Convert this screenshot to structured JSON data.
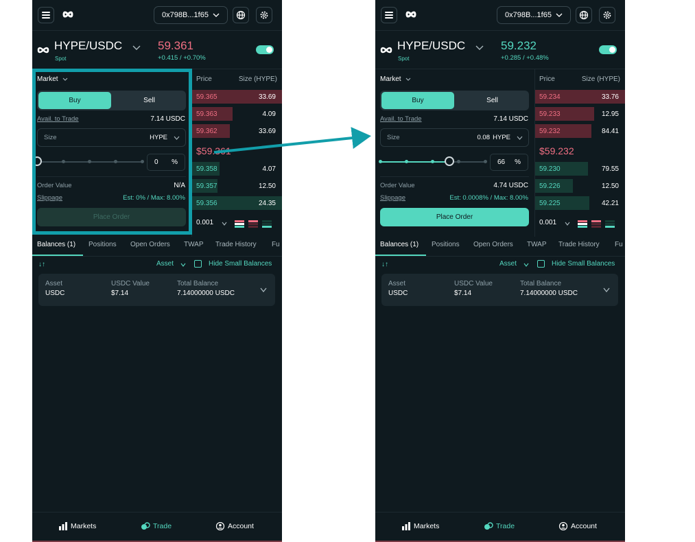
{
  "colors": {
    "bg": "#0f1a1f",
    "accent": "#54d7bf",
    "red": "#f06f83",
    "red_bar": "#5a2631",
    "green_bar": "#163b34",
    "highlight": "#129eaa"
  },
  "screens": [
    {
      "wallet": "0x798B...1f65",
      "pair": "HYPE/USDC",
      "market_kind": "Spot",
      "price": "59.361",
      "price_dir": "down",
      "change": "+0.415 / +0.70%",
      "order_type": "Market",
      "buy_label": "Buy",
      "sell_label": "Sell",
      "avail_label": "Avail. to Trade",
      "avail_value": "7.14 USDC",
      "size_label": "Size",
      "size_value": "",
      "size_unit": "HYPE",
      "slider_percent": 0,
      "percent_value": "0",
      "percent_sign": "%",
      "order_value_label": "Order Value",
      "order_value": "N/A",
      "slippage_label": "Slippage",
      "slippage_value": "Est: 0% / Max: 8.00%",
      "place_order_label": "Place Order",
      "place_order_enabled": false,
      "book_price_header": "Price",
      "book_size_header": "Size (HYPE)",
      "asks": [
        {
          "price": "59.365",
          "size": "33.69",
          "depth": 1.0
        },
        {
          "price": "59.363",
          "size": "4.09",
          "depth": 0.45
        },
        {
          "price": "59.362",
          "size": "33.69",
          "depth": 0.42
        }
      ],
      "mid_price": "$59.361",
      "bids": [
        {
          "price": "59.358",
          "size": "4.07",
          "depth": 0.3
        },
        {
          "price": "59.357",
          "size": "12.50",
          "depth": 0.28
        },
        {
          "price": "59.356",
          "size": "24.35",
          "depth": 1.0
        }
      ],
      "tick_size": "0.001",
      "tabs": [
        "Balances (1)",
        "Positions",
        "Open Orders",
        "TWAP",
        "Trade History",
        "Fu"
      ],
      "asset_filter": "Asset",
      "hide_small_label": "Hide Small Balances",
      "balance_headers": [
        "Asset",
        "USDC Value",
        "Total Balance"
      ],
      "balance_row": [
        "USDC",
        "$7.14",
        "7.14000000 USDC"
      ],
      "nav": [
        "Markets",
        "Trade",
        "Account"
      ]
    },
    {
      "wallet": "0x798B...1f65",
      "pair": "HYPE/USDC",
      "market_kind": "Spot",
      "price": "59.232",
      "price_dir": "up",
      "change": "+0.285 / +0.48%",
      "order_type": "Market",
      "buy_label": "Buy",
      "sell_label": "Sell",
      "avail_label": "Avail. to Trade",
      "avail_value": "7.14 USDC",
      "size_label": "Size",
      "size_value": "0.08",
      "size_unit": "HYPE",
      "slider_percent": 66,
      "percent_value": "66",
      "percent_sign": "%",
      "order_value_label": "Order Value",
      "order_value": "4.74 USDC",
      "slippage_label": "Slippage",
      "slippage_value": "Est: 0.0008% / Max: 8.00%",
      "place_order_label": "Place Order",
      "place_order_enabled": true,
      "book_price_header": "Price",
      "book_size_header": "Size (HYPE)",
      "asks": [
        {
          "price": "59.234",
          "size": "33.76",
          "depth": 1.0
        },
        {
          "price": "59.233",
          "size": "12.95",
          "depth": 0.65
        },
        {
          "price": "59.232",
          "size": "84.41",
          "depth": 0.62
        }
      ],
      "mid_price": "$59.232",
      "bids": [
        {
          "price": "59.230",
          "size": "79.55",
          "depth": 0.58
        },
        {
          "price": "59.226",
          "size": "12.50",
          "depth": 0.42
        },
        {
          "price": "59.225",
          "size": "42.21",
          "depth": 0.6
        }
      ],
      "tick_size": "0.001",
      "tabs": [
        "Balances (1)",
        "Positions",
        "Open Orders",
        "TWAP",
        "Trade History",
        "Fu"
      ],
      "asset_filter": "Asset",
      "hide_small_label": "Hide Small Balances",
      "balance_headers": [
        "Asset",
        "USDC Value",
        "Total Balance"
      ],
      "balance_row": [
        "USDC",
        "$7.14",
        "7.14000000 USDC"
      ],
      "nav": [
        "Markets",
        "Trade",
        "Account"
      ]
    }
  ]
}
